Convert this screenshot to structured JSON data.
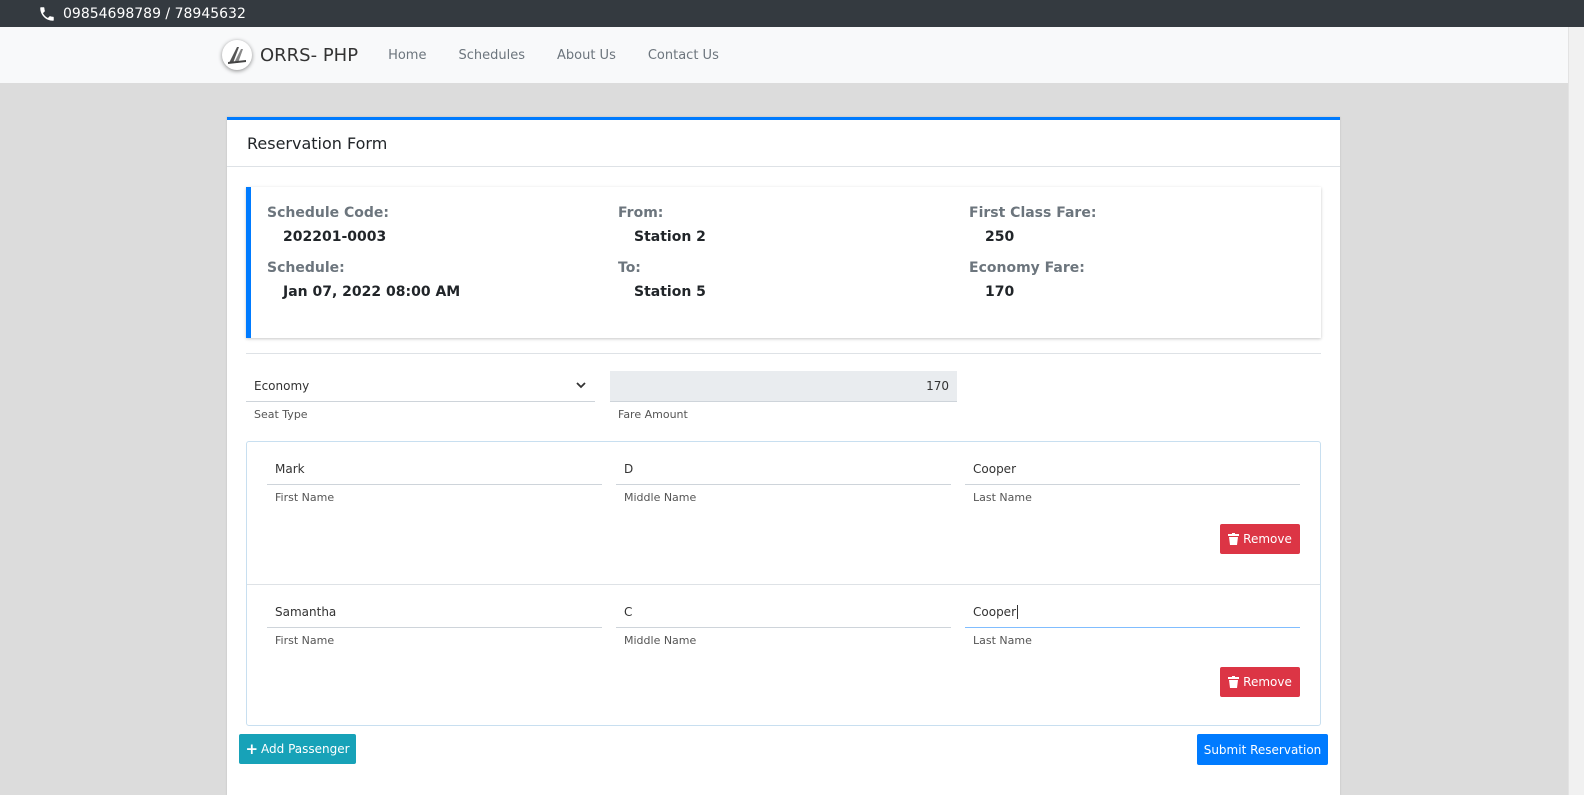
{
  "topbar": {
    "phone": "09854698789 / 78945632"
  },
  "navbar": {
    "brand": "ORRS- PHP",
    "links": [
      "Home",
      "Schedules",
      "About Us",
      "Contact Us"
    ]
  },
  "card": {
    "title": "Reservation Form"
  },
  "schedule_info": {
    "code_label": "Schedule Code:",
    "code": "202201-0003",
    "schedule_label": "Schedule:",
    "schedule": "Jan 07, 2022 08:00 AM",
    "from_label": "From:",
    "from": "Station 2",
    "to_label": "To:",
    "to": "Station 5",
    "first_fare_label": "First Class Fare:",
    "first_fare": "250",
    "economy_fare_label": "Economy Fare:",
    "economy_fare": "170"
  },
  "seat": {
    "selected": "Economy",
    "seat_label": "Seat Type",
    "fare_value": "170",
    "fare_label": "Fare Amount"
  },
  "passengers": [
    {
      "first": "Mark",
      "middle": "D",
      "last": "Cooper",
      "first_label": "First Name",
      "middle_label": "Middle Name",
      "last_label": "Last Name",
      "remove": "Remove"
    },
    {
      "first": "Samantha",
      "middle": "C",
      "last": "Cooper",
      "first_label": "First Name",
      "middle_label": "Middle Name",
      "last_label": "Last Name",
      "remove": "Remove"
    }
  ],
  "actions": {
    "add_passenger": "Add Passenger",
    "submit": "Submit Reservation"
  },
  "colors": {
    "primary": "#007bff",
    "danger": "#dc3545",
    "info": "#17a2b8",
    "dark": "#343a40"
  }
}
